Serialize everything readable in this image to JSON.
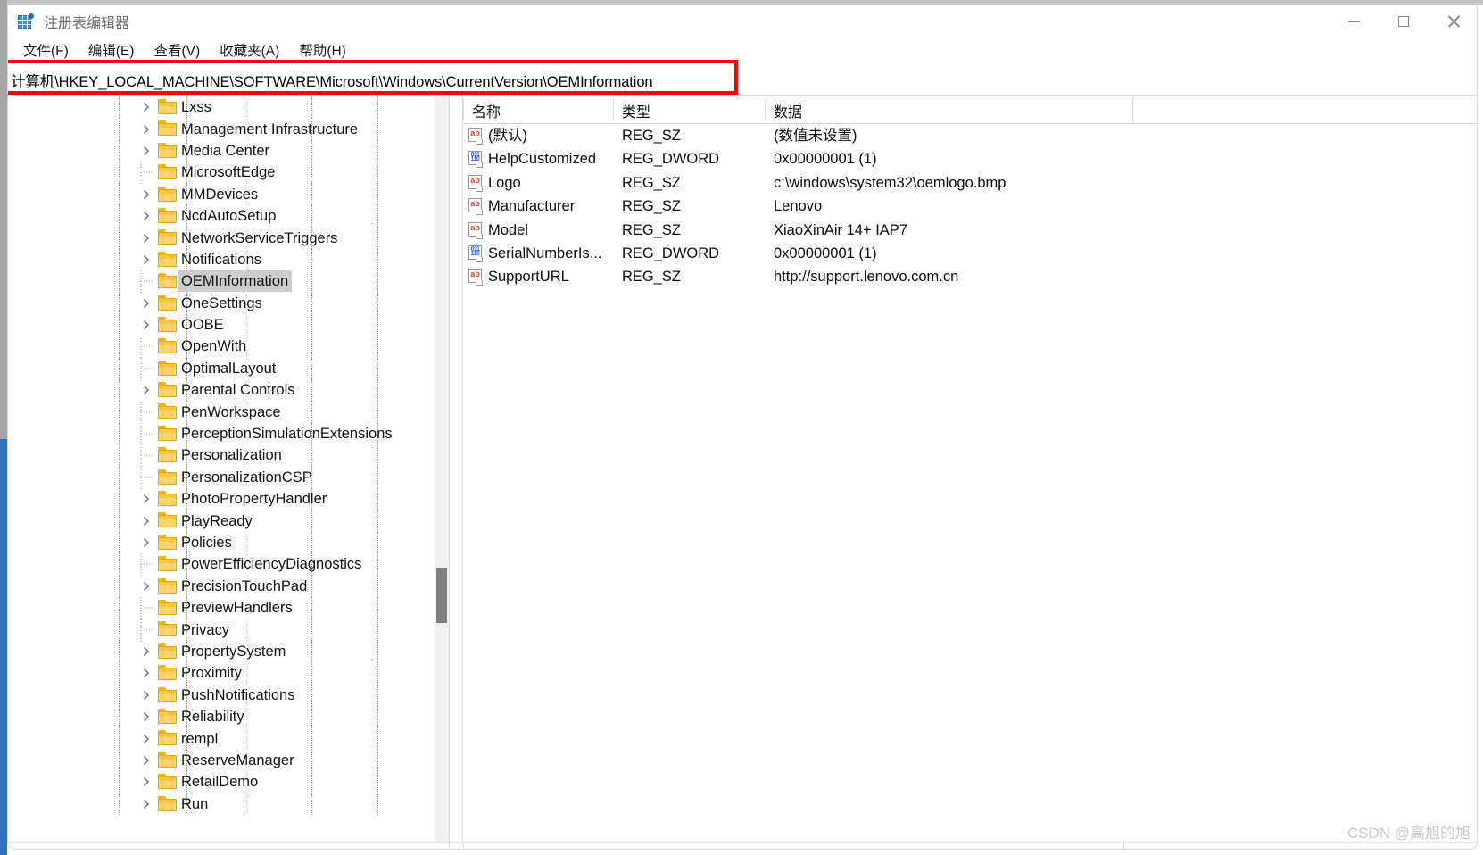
{
  "window": {
    "title": "注册表编辑器",
    "app_icon": "registry-editor-icon",
    "minimize_label": "最小化",
    "maximize_label": "最大化",
    "close_label": "关闭"
  },
  "menubar": {
    "items": [
      {
        "label": "文件(F)"
      },
      {
        "label": "编辑(E)"
      },
      {
        "label": "查看(V)"
      },
      {
        "label": "收藏夹(A)"
      },
      {
        "label": "帮助(H)"
      }
    ]
  },
  "address": {
    "value": "计算机\\HKEY_LOCAL_MACHINE\\SOFTWARE\\Microsoft\\Windows\\CurrentVersion\\OEMInformation",
    "placeholder": "计算机\\"
  },
  "annotation": {
    "color": "#ff0000",
    "target": "address-bar"
  },
  "tree": {
    "items": [
      {
        "label": "Lxss",
        "expandable": true,
        "selected": false
      },
      {
        "label": "Management Infrastructure",
        "expandable": true,
        "selected": false
      },
      {
        "label": "Media Center",
        "expandable": true,
        "selected": false
      },
      {
        "label": "MicrosoftEdge",
        "expandable": false,
        "selected": false
      },
      {
        "label": "MMDevices",
        "expandable": true,
        "selected": false
      },
      {
        "label": "NcdAutoSetup",
        "expandable": true,
        "selected": false
      },
      {
        "label": "NetworkServiceTriggers",
        "expandable": true,
        "selected": false
      },
      {
        "label": "Notifications",
        "expandable": true,
        "selected": false
      },
      {
        "label": "OEMInformation",
        "expandable": false,
        "selected": true
      },
      {
        "label": "OneSettings",
        "expandable": true,
        "selected": false
      },
      {
        "label": "OOBE",
        "expandable": true,
        "selected": false
      },
      {
        "label": "OpenWith",
        "expandable": false,
        "selected": false
      },
      {
        "label": "OptimalLayout",
        "expandable": false,
        "selected": false
      },
      {
        "label": "Parental Controls",
        "expandable": true,
        "selected": false
      },
      {
        "label": "PenWorkspace",
        "expandable": false,
        "selected": false
      },
      {
        "label": "PerceptionSimulationExtensions",
        "expandable": false,
        "selected": false
      },
      {
        "label": "Personalization",
        "expandable": false,
        "selected": false
      },
      {
        "label": "PersonalizationCSP",
        "expandable": false,
        "selected": false
      },
      {
        "label": "PhotoPropertyHandler",
        "expandable": true,
        "selected": false
      },
      {
        "label": "PlayReady",
        "expandable": true,
        "selected": false
      },
      {
        "label": "Policies",
        "expandable": true,
        "selected": false
      },
      {
        "label": "PowerEfficiencyDiagnostics",
        "expandable": false,
        "selected": false
      },
      {
        "label": "PrecisionTouchPad",
        "expandable": true,
        "selected": false
      },
      {
        "label": "PreviewHandlers",
        "expandable": false,
        "selected": false
      },
      {
        "label": "Privacy",
        "expandable": false,
        "selected": false
      },
      {
        "label": "PropertySystem",
        "expandable": true,
        "selected": false
      },
      {
        "label": "Proximity",
        "expandable": true,
        "selected": false
      },
      {
        "label": "PushNotifications",
        "expandable": true,
        "selected": false
      },
      {
        "label": "Reliability",
        "expandable": true,
        "selected": false
      },
      {
        "label": "rempl",
        "expandable": true,
        "selected": false
      },
      {
        "label": "ReserveManager",
        "expandable": true,
        "selected": false
      },
      {
        "label": "RetailDemo",
        "expandable": true,
        "selected": false
      },
      {
        "label": "Run",
        "expandable": true,
        "selected": false
      }
    ],
    "scrollbar": "tree-vertical-scrollbar"
  },
  "values": {
    "columns": [
      {
        "label": "名称"
      },
      {
        "label": "类型"
      },
      {
        "label": "数据"
      }
    ],
    "rows": [
      {
        "name": "(默认)",
        "type": "REG_SZ",
        "data": "(数值未设置)",
        "icon": "string-value-icon"
      },
      {
        "name": "HelpCustomized",
        "type": "REG_DWORD",
        "data": "0x00000001 (1)",
        "icon": "dword-value-icon"
      },
      {
        "name": "Logo",
        "type": "REG_SZ",
        "data": "c:\\windows\\system32\\oemlogo.bmp",
        "icon": "string-value-icon"
      },
      {
        "name": "Manufacturer",
        "type": "REG_SZ",
        "data": "Lenovo",
        "icon": "string-value-icon"
      },
      {
        "name": "Model",
        "type": "REG_SZ",
        "data": "XiaoXinAir 14+ IAP7",
        "icon": "string-value-icon"
      },
      {
        "name": "SerialNumberIs...",
        "type": "REG_DWORD",
        "data": "0x00000001 (1)",
        "icon": "dword-value-icon"
      },
      {
        "name": "SupportURL",
        "type": "REG_SZ",
        "data": "http://support.lenovo.com.cn",
        "icon": "string-value-icon"
      }
    ]
  },
  "watermark": {
    "text": "CSDN @高旭的旭"
  },
  "colors": {
    "selection": "#cdcdcd",
    "folder": "#fcd26a",
    "annotation": "#ff0000",
    "accent": "#2f72bd"
  }
}
